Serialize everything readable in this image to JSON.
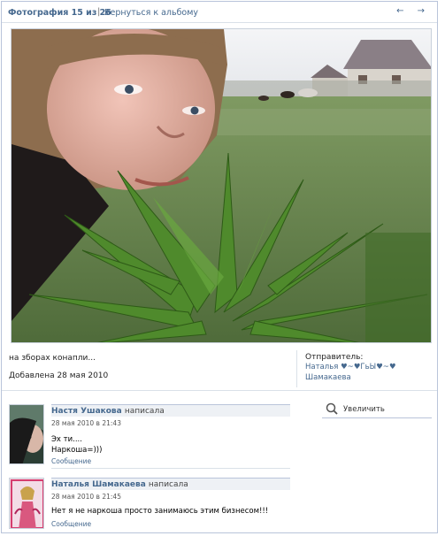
{
  "header": {
    "title": "Фотография 15 из 26",
    "separator": "|",
    "back_link": "Вернуться к альбому",
    "arrows": "← →"
  },
  "photo_info": {
    "description": "на зборах конапли...",
    "added": "Добавлена 28 мая 2010",
    "sender_label": "Отправитель:",
    "sender_name_line1": "Наталья ♥~♥ГьЫ♥~♥",
    "sender_name_line2": "Шамакаева"
  },
  "actions": {
    "zoom_label": "Увеличить"
  },
  "comments": [
    {
      "author": "Настя Ушакова",
      "wrote": "написала",
      "date": "28 мая 2010 в 21:43",
      "line1": "Эх ти....",
      "line2": "Наркоша=)))",
      "message_link": "Сообщение"
    },
    {
      "author": "Наталья Шамакаева",
      "wrote": "написала",
      "date": "28 мая 2010 в 21:45",
      "line1": "Нет я не наркоша просто занимаюсь этим бизнесом!!!",
      "message_link": "Сообщение"
    }
  ],
  "colors": {
    "link": "#45688e",
    "border": "#b9c4da"
  }
}
